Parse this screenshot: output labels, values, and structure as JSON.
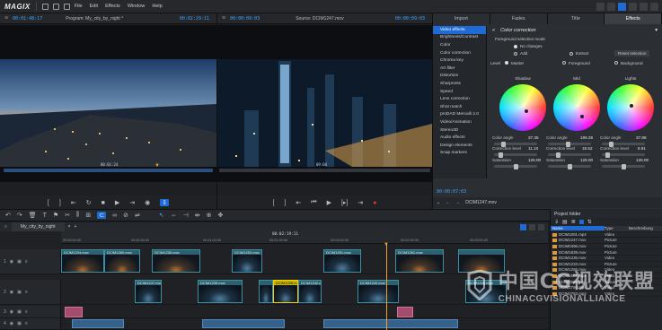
{
  "app": {
    "logo": "MAGIX",
    "menus": [
      "File",
      "Edit",
      "Effects",
      "Window",
      "Help"
    ]
  },
  "program_monitor": {
    "tc_left": "00:01:48:17",
    "title": "Program: My_city_by_night *",
    "tc_right": "00:02:29:11",
    "scrub_tc": "00:01:24"
  },
  "source_monitor": {
    "tc_left": "00:00:09:03",
    "title": "Source: DCIM1247.mov",
    "tc_right": "00:00:09:03",
    "scrub_tc": "09:04",
    "footer_tc": "00:00:07:03",
    "footer_file": "DCIM1247.mov"
  },
  "tabs": [
    {
      "label": "Import",
      "active": false
    },
    {
      "label": "Fades",
      "active": false
    },
    {
      "label": "Title",
      "active": false
    },
    {
      "label": "Effects",
      "active": true
    }
  ],
  "effects_list": {
    "items": [
      {
        "label": "Video effects",
        "selected": true
      },
      {
        "label": "Brightness/Contrast",
        "selected": false
      },
      {
        "label": "Color",
        "selected": false
      },
      {
        "label": "Color correction",
        "selected": false
      },
      {
        "label": "Chroma key",
        "selected": false
      },
      {
        "label": "Art filter",
        "selected": false
      },
      {
        "label": "Distortion",
        "selected": false
      },
      {
        "label": "Sharpness",
        "selected": false
      },
      {
        "label": "Speed",
        "selected": false
      },
      {
        "label": "Lens correction",
        "selected": false
      },
      {
        "label": "Shot match",
        "selected": false
      },
      {
        "label": "proDAD Mercalli 2.0",
        "selected": false
      },
      {
        "label": "Video/Animation",
        "selected": false
      },
      {
        "label": "Stereo3D",
        "selected": false
      },
      {
        "label": "Audio effects",
        "selected": false
      },
      {
        "label": "Design elements",
        "selected": false
      },
      {
        "label": "Snap markers",
        "selected": false
      }
    ]
  },
  "color_correction": {
    "title": "Color correction",
    "fg_mode_label": "Foreground selection mode",
    "no_changes": "No changes",
    "add": "Add",
    "extract": "Extract",
    "reset": "Reset selection",
    "level_label": "Level",
    "level_master": "Master",
    "level_foreground": "Foreground",
    "level_background": "Background",
    "wheels": [
      {
        "name": "Shadow",
        "color_angle": "37.35",
        "correction_level": "11.10",
        "saturation": "128.00"
      },
      {
        "name": "Mid",
        "color_angle": "199.28",
        "correction_level": "19.52",
        "saturation": "128.00"
      },
      {
        "name": "Lights",
        "color_angle": "37.88",
        "correction_level": "8.91",
        "saturation": "128.00"
      }
    ],
    "lbl_angle": "Color angle",
    "lbl_corr": "Correction level",
    "lbl_sat": "Saturation"
  },
  "timeline": {
    "project_tab": "My_city_by_night",
    "ruler_tc": "00:02:19:11",
    "ruler_marks": [
      "00:00:00:00",
      "00:00:30:00",
      "00:01:00:00",
      "00:01:30:00",
      "00:02:00:00",
      "00:02:30:00",
      "00:03:00:00"
    ],
    "clips_row1": [
      "DCIM1234.mov",
      "DCIM1260.mov",
      "DCIM1236.mov",
      "DCIM1253.mov",
      "DCIM1251.mov",
      "DCIM1261.mov"
    ],
    "clips_row2": [
      "DCIM1247.mov",
      "DCIM1235.mov",
      "DCIM1238.mov",
      "DCIM1242.mov",
      "DCIM1240.mov",
      "DCIM1246.mov"
    ]
  },
  "project_folder": {
    "title": "Project folder",
    "col_name": "Name",
    "col_type": "Type",
    "col_desc": "Beschreibung",
    "rows": [
      {
        "name": "DCIM1001.mp4",
        "type": "Video"
      },
      {
        "name": "DCIM1247.mov",
        "type": "Picture"
      },
      {
        "name": "DCIM0496.mov",
        "type": "Picture"
      },
      {
        "name": "DCIM1839.mov",
        "type": "Picture"
      },
      {
        "name": "DCIM1235.mov",
        "type": "Video"
      },
      {
        "name": "DCIM1233.mov",
        "type": "Picture"
      },
      {
        "name": "DCIM1256.mov",
        "type": "Video"
      },
      {
        "name": "DCIM2582.mp4",
        "type": "Video"
      },
      {
        "name": "DCIM2596.jpg",
        "type": "Picture"
      },
      {
        "name": "DCIM2794.mp4",
        "type": "Video"
      },
      {
        "name": "DCIM2783.mp4",
        "type": "Video"
      }
    ]
  },
  "watermark": {
    "cn": "中国CG视效联盟",
    "en": "CHINACGVISIONALLIANCE"
  },
  "colors": {
    "accent": "#1e6bd6",
    "timecode": "#3ea6ff",
    "playhead": "#f0a020"
  }
}
